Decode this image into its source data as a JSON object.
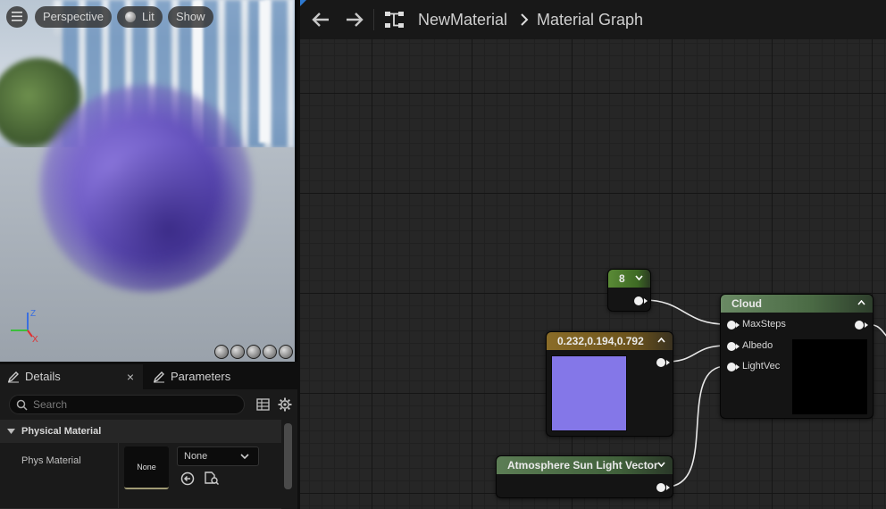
{
  "viewport": {
    "view_mode": "Perspective",
    "lighting": "Lit",
    "show_label": "Show",
    "axis_z": "Z",
    "axis_x": "X"
  },
  "details_panel": {
    "tabs": [
      {
        "label": "Details",
        "close": "×"
      },
      {
        "label": "Parameters"
      }
    ],
    "search_placeholder": "Search",
    "section_title": "Physical Material",
    "property": {
      "label": "Phys Material",
      "thumbnail_text": "None",
      "dropdown_value": "None"
    }
  },
  "graph": {
    "breadcrumb": {
      "asset": "NewMaterial",
      "graph": "Material Graph"
    },
    "nodes": {
      "constant": {
        "title": "8"
      },
      "color": {
        "title": "0.232,0.194,0.792",
        "swatch_color": "#8477e8"
      },
      "sun_vector": {
        "title": "Atmosphere Sun Light Vector"
      },
      "cloud": {
        "title": "Cloud",
        "inputs": [
          "MaxSteps",
          "Albedo",
          "LightVec"
        ]
      }
    }
  },
  "colors": {
    "accent": "#2e7ad1",
    "constant_header": "#5a8a36",
    "color_header": "#8a6c28",
    "function_header": "#6a8a64"
  }
}
